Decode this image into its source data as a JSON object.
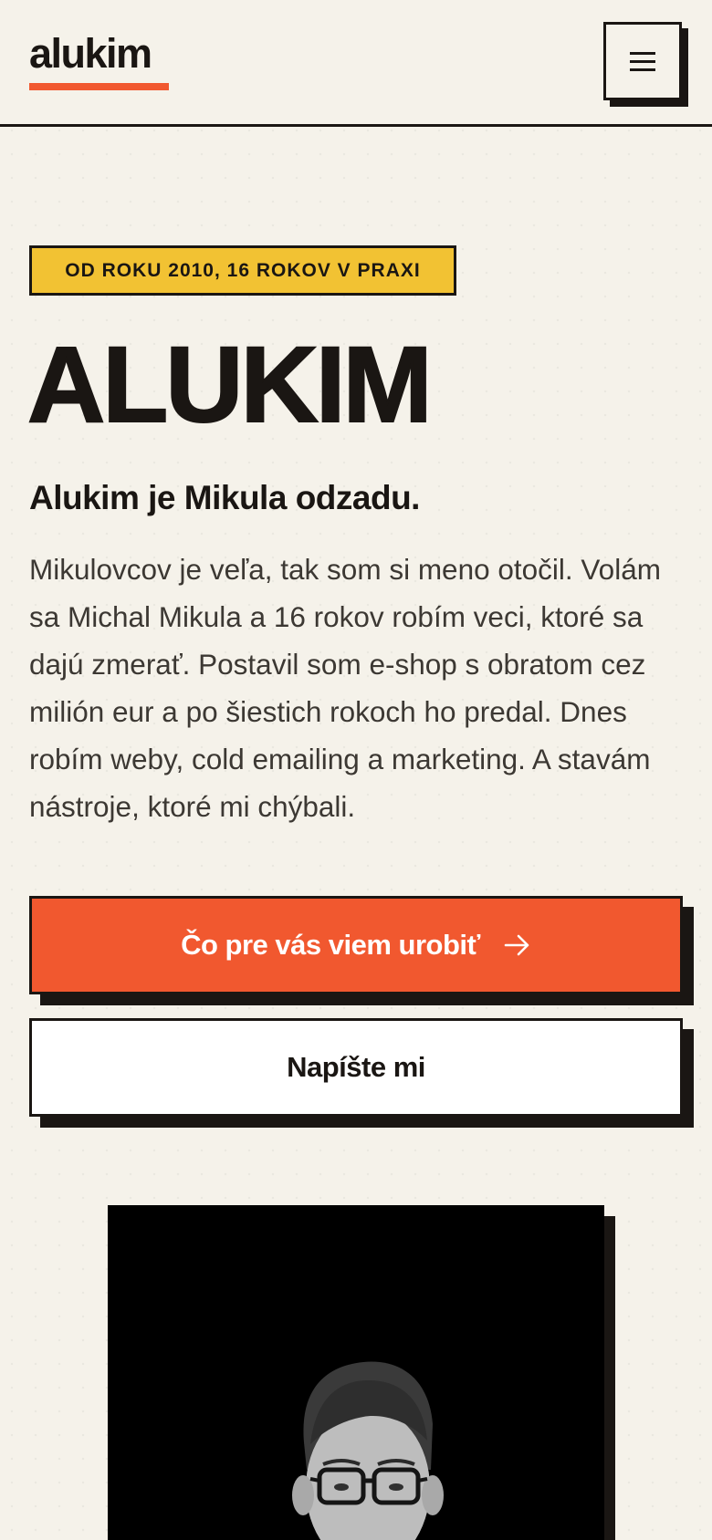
{
  "header": {
    "logo_text": "alukim",
    "menu_icon": "hamburger-menu-icon"
  },
  "hero": {
    "badge": "OD ROKU 2010, 16 ROKOV V PRAXI",
    "title": "ALUKIM",
    "subtitle": "Alukim je Mikula odzadu.",
    "intro": "Mikulovcov je veľa, tak som si meno otočil. Volám sa Michal Mikula a 16 rokov robím veci, ktoré sa dajú zmerať. Postavil som e-shop s obratom cez milión eur a po šiestich rokoch ho predal. Dnes robím weby, cold emailing a marketing. A stavám nástroje, ktoré mi chýbali.",
    "primary_button": "Čo pre vás viem urobiť",
    "primary_button_icon": "arrow-right-icon",
    "secondary_button": "Napíšte mi"
  },
  "colors": {
    "background": "#f5f2ea",
    "accent": "#f1582f",
    "badge": "#f2c233",
    "ink": "#1a1613"
  }
}
